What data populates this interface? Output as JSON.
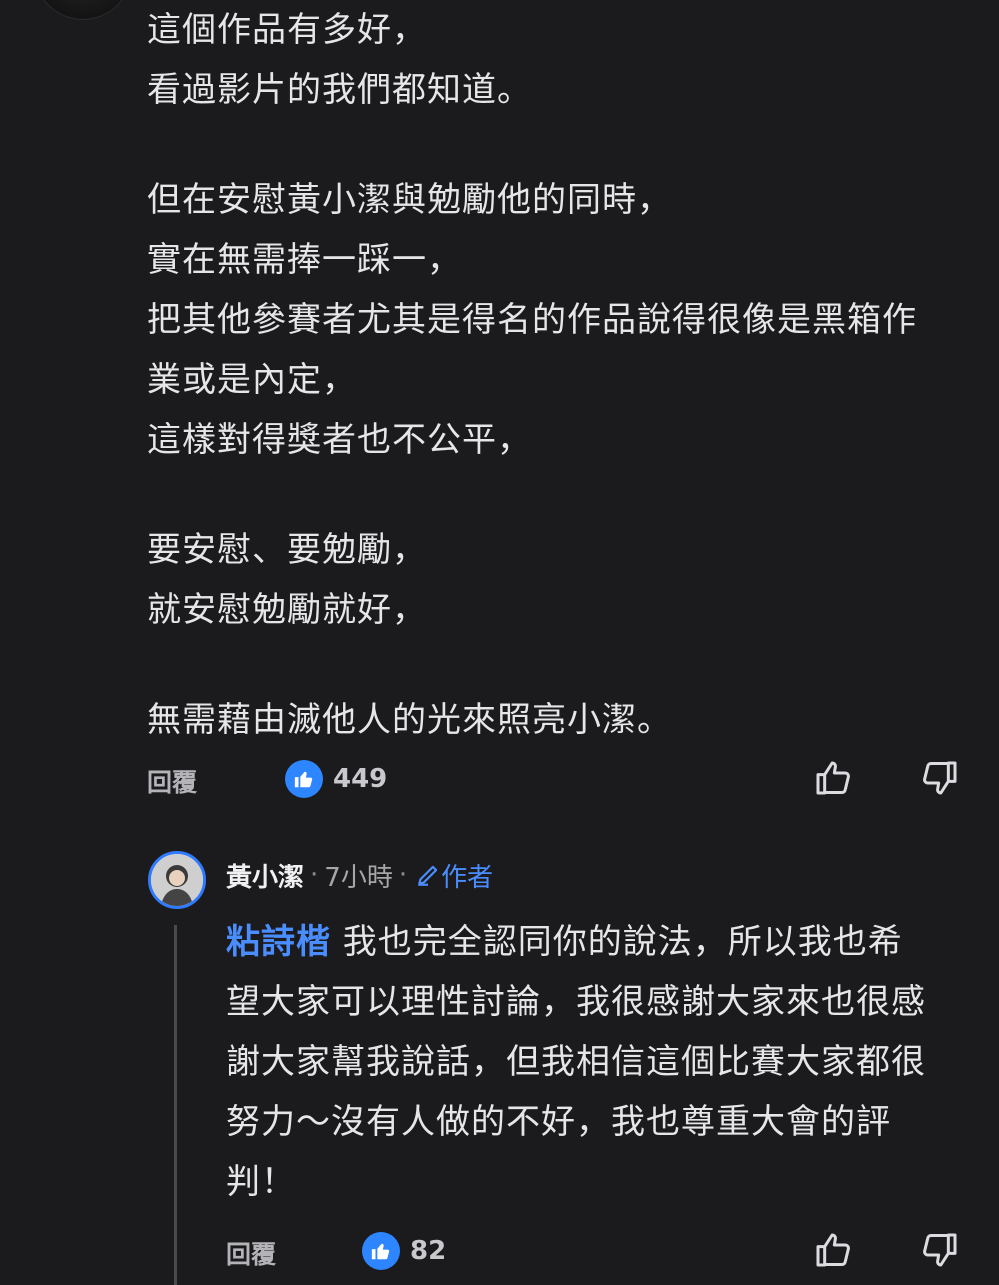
{
  "comment": {
    "lines": [
      "這個作品有多好，",
      "看過影片的我們都知道。",
      "",
      "但在安慰黃小潔與勉勵他的同時，",
      "實在無需捧一踩一，",
      "把其他參賽者尤其是得名的作品說得很像是黑箱作",
      "業或是內定，",
      "這樣對得獎者也不公平，",
      "",
      "要安慰、要勉勵，",
      "就安慰勉勵就好，",
      "",
      "無需藉由滅他人的光來照亮小潔。"
    ],
    "reply_label": "回覆",
    "like_count": "449"
  },
  "reply": {
    "author": "黃小潔",
    "time": "7小時",
    "badge_label": "作者",
    "mention": "粘詩楷",
    "lines": [
      " 我也完全認同你的說法，所以我也希",
      "望大家可以理性討論，我很感謝大家來也很感",
      "謝大家幫我說話，但我相信這個比賽大家都很",
      "努力～沒有人做的不好，我也尊重大會的評",
      "判！"
    ],
    "reply_label": "回覆",
    "like_count": "82"
  },
  "colors": {
    "background": "#1b1b1d",
    "accent": "#2d86ff",
    "mention": "#4a8dff"
  },
  "icons": [
    "like-bubble-icon",
    "thumbs-up-icon",
    "thumbs-down-icon",
    "pencil-icon"
  ]
}
